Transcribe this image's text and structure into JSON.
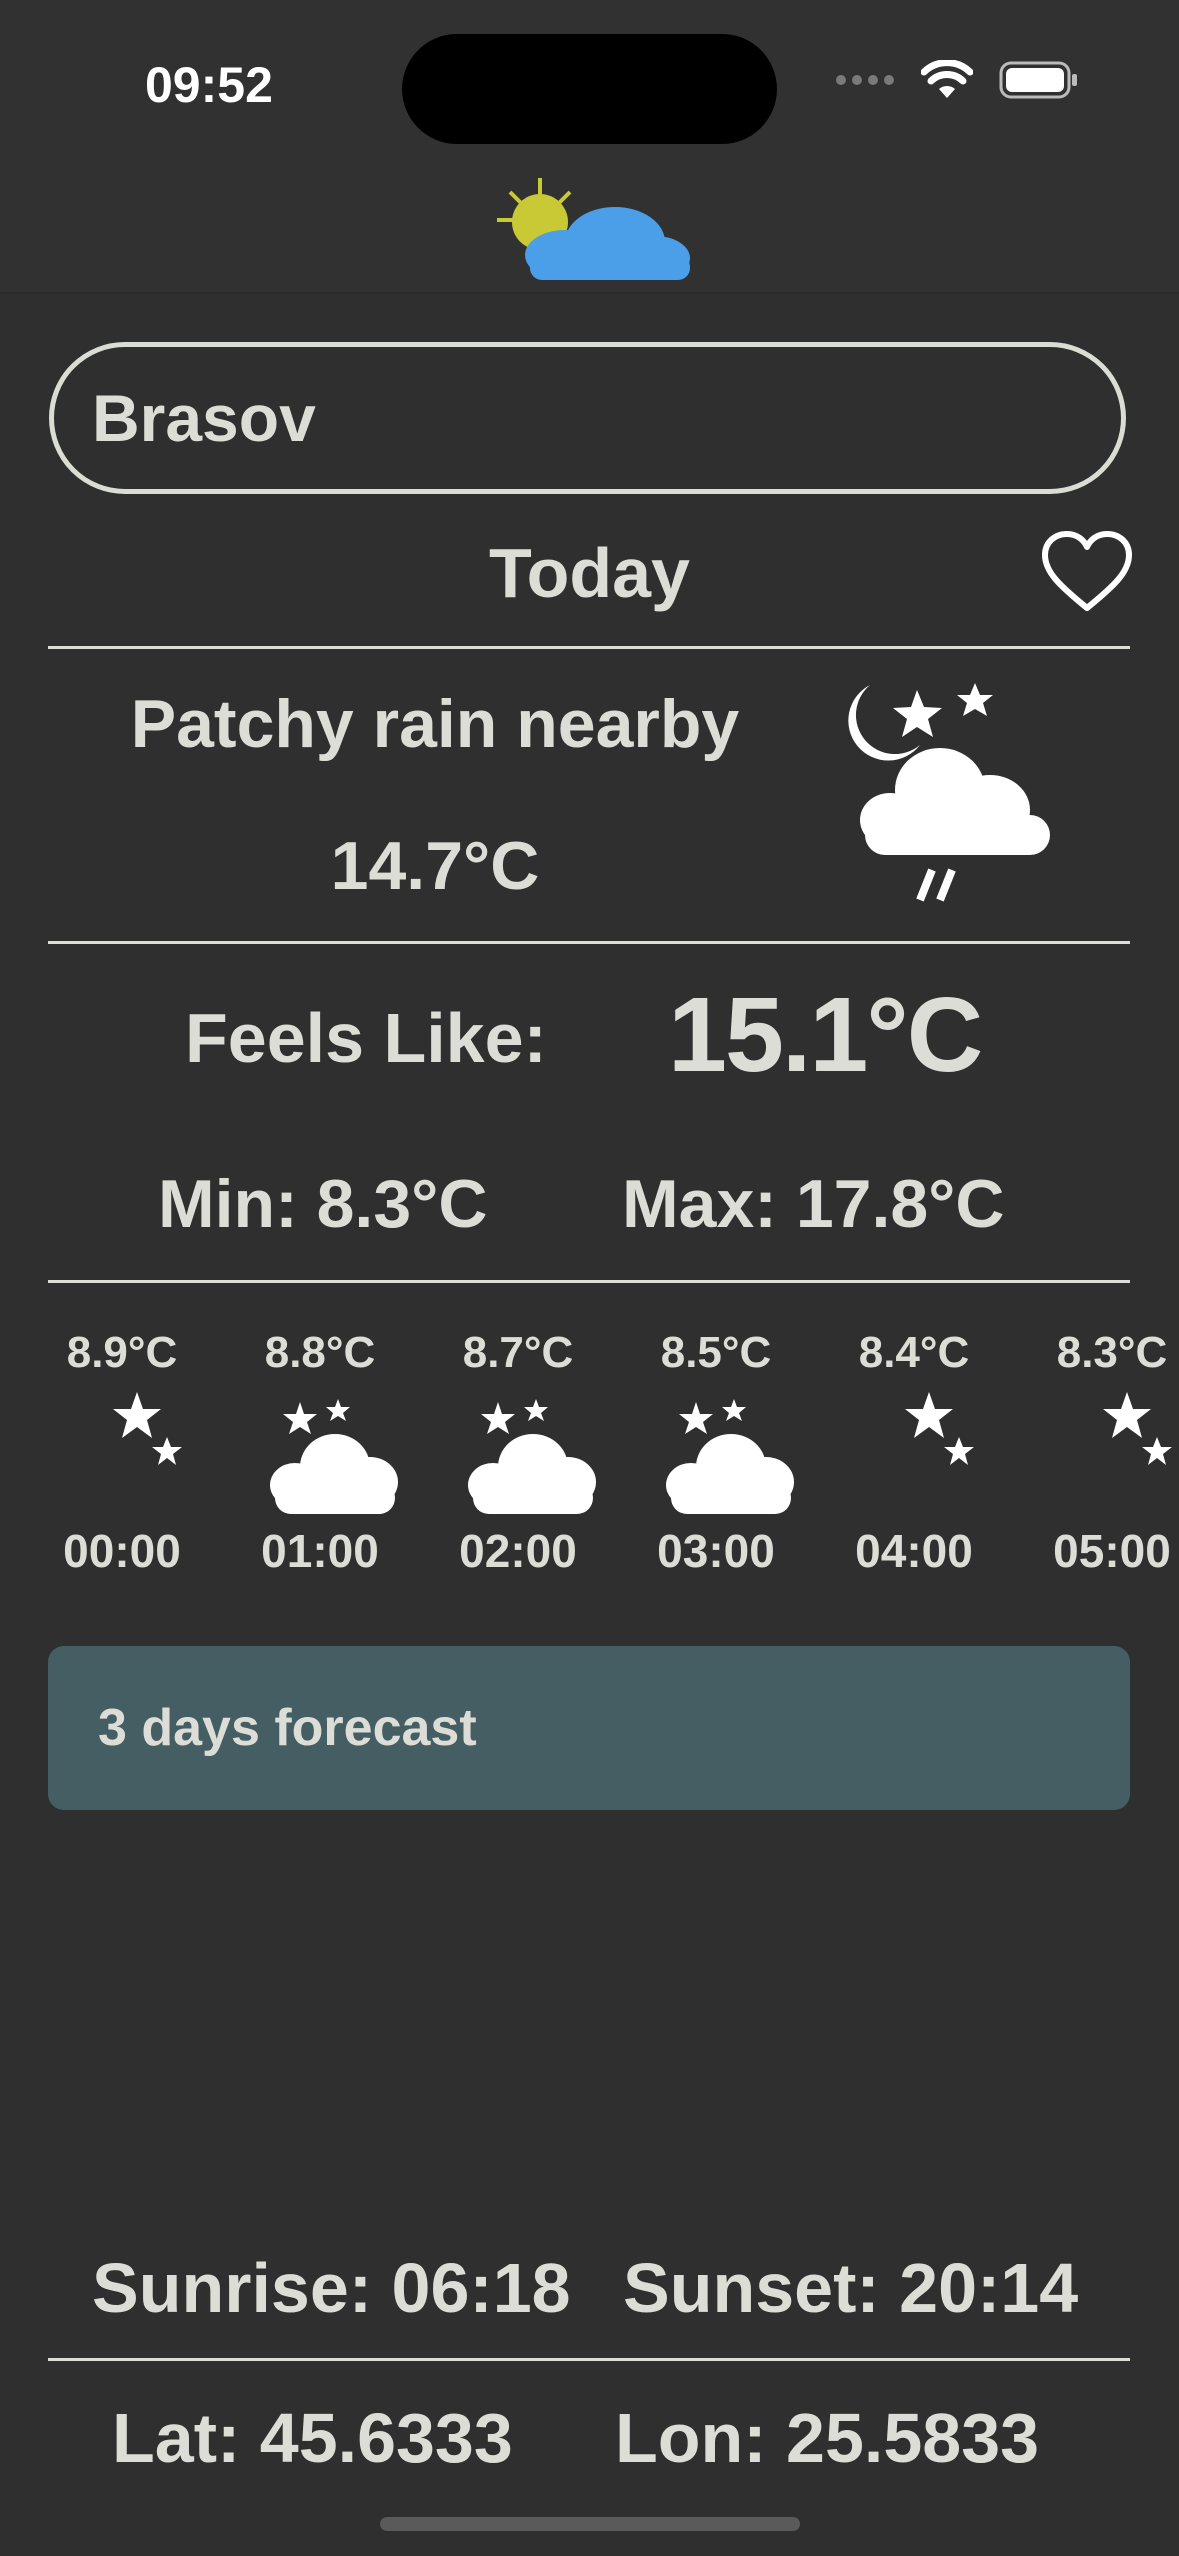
{
  "status_bar": {
    "time": "09:52"
  },
  "header": {
    "logo_icon": "sun-cloud-moon-logo"
  },
  "search": {
    "value": "Brasov"
  },
  "today": {
    "label": "Today",
    "favorite_icon": "heart-outline-icon"
  },
  "current": {
    "condition": "Patchy rain nearby",
    "temperature": "14.7°C",
    "icon": "night-cloud-rain-icon"
  },
  "feels_like": {
    "label": "Feels Like:",
    "value": "15.1°C"
  },
  "min_max": {
    "min": "Min: 8.3°C",
    "max": "Max: 17.8°C"
  },
  "hourly": [
    {
      "temp": "8.9°C",
      "time": "00:00",
      "icon": "moon-stars-icon"
    },
    {
      "temp": "8.8°C",
      "time": "01:00",
      "icon": "moon-cloud-icon"
    },
    {
      "temp": "8.7°C",
      "time": "02:00",
      "icon": "moon-cloud-icon"
    },
    {
      "temp": "8.5°C",
      "time": "03:00",
      "icon": "moon-cloud-icon"
    },
    {
      "temp": "8.4°C",
      "time": "04:00",
      "icon": "moon-stars-icon"
    },
    {
      "temp": "8.3°C",
      "time": "05:00",
      "icon": "moon-stars-icon"
    }
  ],
  "forecast_button": {
    "label": "3 days forecast"
  },
  "sun": {
    "sunrise": "Sunrise: 06:18",
    "sunset": "Sunset: 20:14"
  },
  "location": {
    "lat": "Lat: 45.6333",
    "lon": "Lon: 25.5833"
  },
  "colors": {
    "background": "#2f2f2f",
    "text": "#dcddd6",
    "button": "#455e64"
  }
}
